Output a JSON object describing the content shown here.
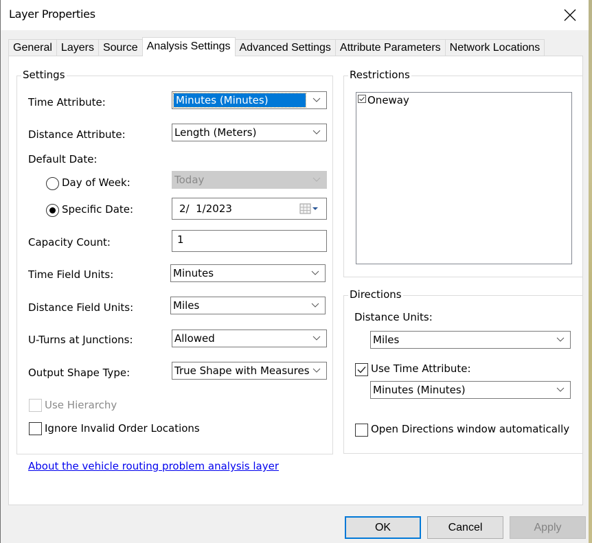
{
  "window": {
    "title": "Layer Properties",
    "close_icon": "close-icon"
  },
  "tabs": [
    {
      "label": "General",
      "active": false
    },
    {
      "label": "Layers",
      "active": false
    },
    {
      "label": "Source",
      "active": false
    },
    {
      "label": "Analysis Settings",
      "active": true
    },
    {
      "label": "Advanced Settings",
      "active": false
    },
    {
      "label": "Attribute Parameters",
      "active": false
    },
    {
      "label": "Network Locations",
      "active": false
    }
  ],
  "settings": {
    "group_label": "Settings",
    "time_attribute": {
      "label": "Time Attribute:",
      "value": "Minutes (Minutes)"
    },
    "distance_attribute": {
      "label": "Distance Attribute:",
      "value": "Length (Meters)"
    },
    "default_date": {
      "label": "Default Date:",
      "day_of_week": {
        "label": "Day of Week:",
        "selected": false,
        "value": "Today",
        "enabled": false
      },
      "specific_date": {
        "label": "Specific Date:",
        "selected": true,
        "value": "2/  1/2023"
      }
    },
    "capacity_count": {
      "label": "Capacity Count:",
      "value": "1"
    },
    "time_field_units": {
      "label": "Time Field Units:",
      "value": "Minutes"
    },
    "distance_field_units": {
      "label": "Distance Field Units:",
      "value": "Miles"
    },
    "uturns": {
      "label": "U-Turns at Junctions:",
      "value": "Allowed"
    },
    "output_shape_type": {
      "label": "Output Shape Type:",
      "value": "True Shape with Measures"
    },
    "use_hierarchy": {
      "label": "Use Hierarchy",
      "checked": false,
      "enabled": false
    },
    "ignore_invalid": {
      "label": "Ignore Invalid Order Locations",
      "checked": false
    }
  },
  "restrictions": {
    "group_label": "Restrictions",
    "items": [
      {
        "label": "Oneway",
        "checked": true
      }
    ]
  },
  "directions": {
    "group_label": "Directions",
    "distance_units": {
      "label": "Distance Units:",
      "value": "Miles"
    },
    "use_time_attribute": {
      "label": "Use Time Attribute:",
      "checked": true,
      "value": "Minutes (Minutes)"
    },
    "open_window": {
      "label": "Open Directions window automatically",
      "checked": false
    }
  },
  "about_link": "About the vehicle routing problem analysis layer",
  "buttons": {
    "ok": "OK",
    "cancel": "Cancel",
    "apply": "Apply"
  },
  "colors": {
    "selection": "#0078d7",
    "link": "#0000ee",
    "default_button_border": "#0078d7"
  }
}
